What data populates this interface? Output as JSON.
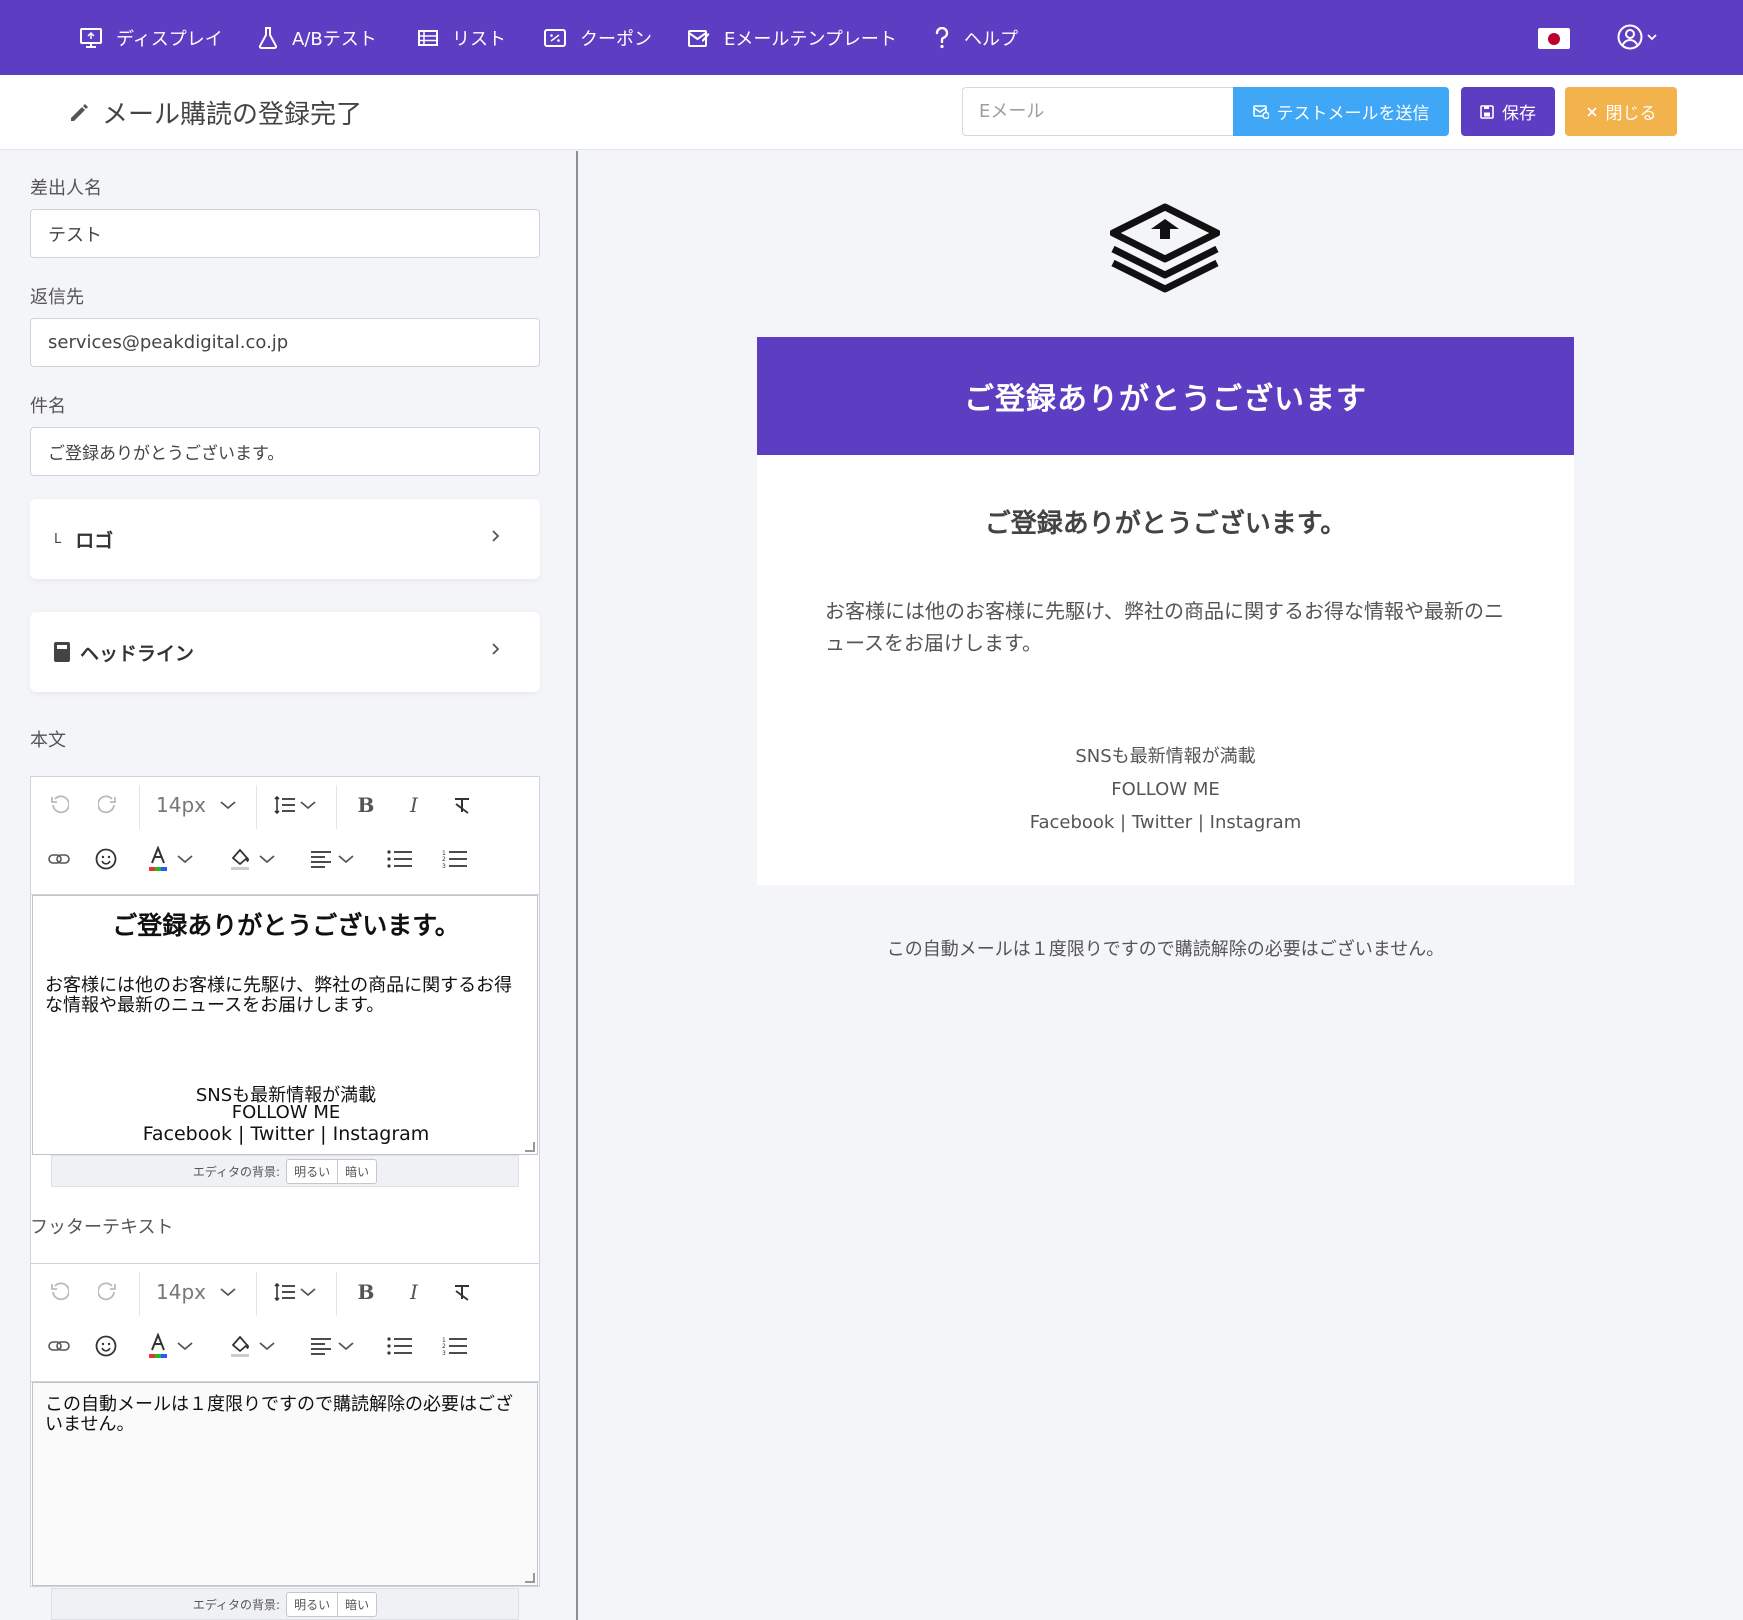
{
  "nav": {
    "items": [
      {
        "label": "ディスプレイ",
        "icon": "monitor-icon"
      },
      {
        "label": "A/Bテスト",
        "icon": "flask-icon"
      },
      {
        "label": "リスト",
        "icon": "list-icon"
      },
      {
        "label": "クーポン",
        "icon": "coupon-icon"
      },
      {
        "label": "Eメールテンプレート",
        "icon": "email-template-icon"
      },
      {
        "label": "ヘルプ",
        "icon": "question-icon"
      }
    ],
    "flag": "japan-flag-icon",
    "user": "user-circle-icon"
  },
  "header": {
    "title": "メール購読の登録完了",
    "email_placeholder": "Eメール",
    "test_button": "テストメールを送信",
    "save_button": "保存",
    "close_button": "閉じる"
  },
  "form": {
    "sender_label": "差出人名",
    "sender_value": "テスト",
    "reply_label": "返信先",
    "reply_value": "services@peakdigital.co.jp",
    "subject_label": "件名",
    "subject_value": "ご登録ありがとうございます。",
    "logo_section": {
      "prefix": "L",
      "label": "ロゴ"
    },
    "headline_section": {
      "label": "ヘッドライン"
    },
    "body_label": "本文",
    "footer_label": "フッターテキスト"
  },
  "editor": {
    "font_size": "14px",
    "bg_label": "エディタの背景:",
    "bg_light": "明るい",
    "bg_dark": "暗い"
  },
  "body_editor": {
    "title": "ご登録ありがとうございます。",
    "text": "お客様には他のお客様に先駆け、弊社の商品に関するお得な情報や最新のニュースをお届けします。",
    "sns": "SNSも最新情報が満載",
    "follow": "FOLLOW ME",
    "links": "Facebook | Twitter | Instagram"
  },
  "footer_editor": {
    "text": "この自動メールは１度限りですので購読解除の必要はございません。"
  },
  "preview": {
    "header": "ご登録ありがとうございます",
    "title": "ご登録ありがとうございます。",
    "text": "お客様には他のお客様に先駆け、弊社の商品に関するお得な情報や最新のニュースをお届けします。",
    "sns": "SNSも最新情報が満載",
    "follow": "FOLLOW ME",
    "links": "Facebook | Twitter | Instagram",
    "footer": "この自動メールは１度限りですので購読解除の必要はございません。"
  },
  "colors": {
    "brand": "#5d3dc2",
    "test_button": "#3fa7f5",
    "close_button": "#f2b24c"
  }
}
